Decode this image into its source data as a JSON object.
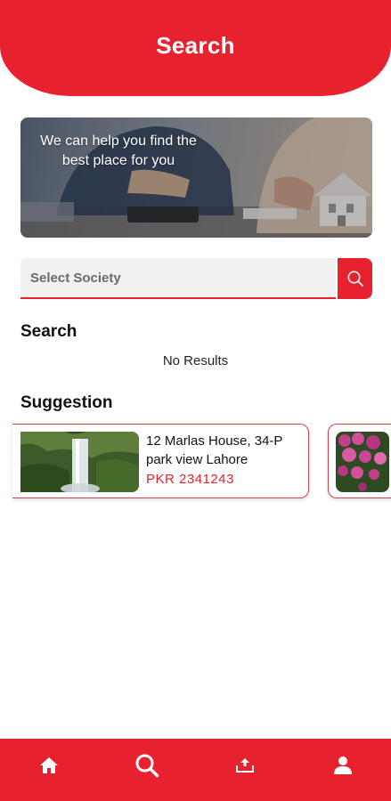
{
  "header": {
    "title": "Search"
  },
  "banner": {
    "text": "We can help you find the best place for you"
  },
  "search": {
    "placeholder": "Select Society"
  },
  "results": {
    "heading": "Search",
    "empty_text": "No Results"
  },
  "suggestions": {
    "heading": "Suggestion",
    "items": [
      {
        "title": "12 Marlas House, 34-P park view Lahore",
        "price": "PKR 2341243"
      }
    ]
  },
  "nav": [
    "home-icon",
    "search-icon",
    "upload-icon",
    "profile-icon"
  ],
  "colors": {
    "accent": "#e8212e",
    "background": "#ffffff"
  }
}
